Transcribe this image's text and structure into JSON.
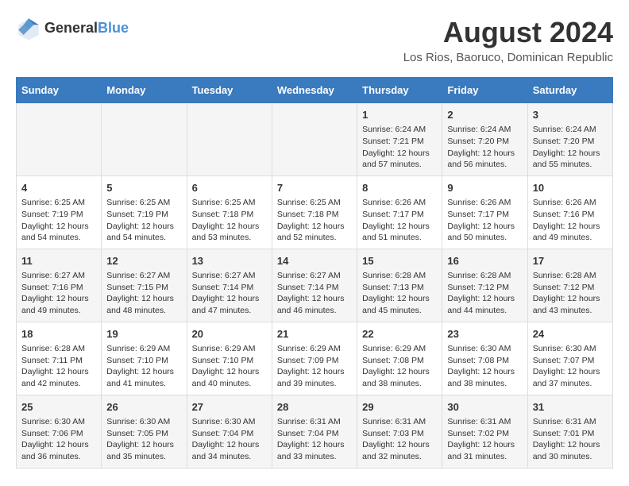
{
  "header": {
    "logo_line1": "General",
    "logo_line2": "Blue",
    "month": "August 2024",
    "location": "Los Rios, Baoruco, Dominican Republic"
  },
  "weekdays": [
    "Sunday",
    "Monday",
    "Tuesday",
    "Wednesday",
    "Thursday",
    "Friday",
    "Saturday"
  ],
  "weeks": [
    [
      {
        "day": "",
        "info": ""
      },
      {
        "day": "",
        "info": ""
      },
      {
        "day": "",
        "info": ""
      },
      {
        "day": "",
        "info": ""
      },
      {
        "day": "1",
        "info": "Sunrise: 6:24 AM\nSunset: 7:21 PM\nDaylight: 12 hours\nand 57 minutes."
      },
      {
        "day": "2",
        "info": "Sunrise: 6:24 AM\nSunset: 7:20 PM\nDaylight: 12 hours\nand 56 minutes."
      },
      {
        "day": "3",
        "info": "Sunrise: 6:24 AM\nSunset: 7:20 PM\nDaylight: 12 hours\nand 55 minutes."
      }
    ],
    [
      {
        "day": "4",
        "info": "Sunrise: 6:25 AM\nSunset: 7:19 PM\nDaylight: 12 hours\nand 54 minutes."
      },
      {
        "day": "5",
        "info": "Sunrise: 6:25 AM\nSunset: 7:19 PM\nDaylight: 12 hours\nand 54 minutes."
      },
      {
        "day": "6",
        "info": "Sunrise: 6:25 AM\nSunset: 7:18 PM\nDaylight: 12 hours\nand 53 minutes."
      },
      {
        "day": "7",
        "info": "Sunrise: 6:25 AM\nSunset: 7:18 PM\nDaylight: 12 hours\nand 52 minutes."
      },
      {
        "day": "8",
        "info": "Sunrise: 6:26 AM\nSunset: 7:17 PM\nDaylight: 12 hours\nand 51 minutes."
      },
      {
        "day": "9",
        "info": "Sunrise: 6:26 AM\nSunset: 7:17 PM\nDaylight: 12 hours\nand 50 minutes."
      },
      {
        "day": "10",
        "info": "Sunrise: 6:26 AM\nSunset: 7:16 PM\nDaylight: 12 hours\nand 49 minutes."
      }
    ],
    [
      {
        "day": "11",
        "info": "Sunrise: 6:27 AM\nSunset: 7:16 PM\nDaylight: 12 hours\nand 49 minutes."
      },
      {
        "day": "12",
        "info": "Sunrise: 6:27 AM\nSunset: 7:15 PM\nDaylight: 12 hours\nand 48 minutes."
      },
      {
        "day": "13",
        "info": "Sunrise: 6:27 AM\nSunset: 7:14 PM\nDaylight: 12 hours\nand 47 minutes."
      },
      {
        "day": "14",
        "info": "Sunrise: 6:27 AM\nSunset: 7:14 PM\nDaylight: 12 hours\nand 46 minutes."
      },
      {
        "day": "15",
        "info": "Sunrise: 6:28 AM\nSunset: 7:13 PM\nDaylight: 12 hours\nand 45 minutes."
      },
      {
        "day": "16",
        "info": "Sunrise: 6:28 AM\nSunset: 7:12 PM\nDaylight: 12 hours\nand 44 minutes."
      },
      {
        "day": "17",
        "info": "Sunrise: 6:28 AM\nSunset: 7:12 PM\nDaylight: 12 hours\nand 43 minutes."
      }
    ],
    [
      {
        "day": "18",
        "info": "Sunrise: 6:28 AM\nSunset: 7:11 PM\nDaylight: 12 hours\nand 42 minutes."
      },
      {
        "day": "19",
        "info": "Sunrise: 6:29 AM\nSunset: 7:10 PM\nDaylight: 12 hours\nand 41 minutes."
      },
      {
        "day": "20",
        "info": "Sunrise: 6:29 AM\nSunset: 7:10 PM\nDaylight: 12 hours\nand 40 minutes."
      },
      {
        "day": "21",
        "info": "Sunrise: 6:29 AM\nSunset: 7:09 PM\nDaylight: 12 hours\nand 39 minutes."
      },
      {
        "day": "22",
        "info": "Sunrise: 6:29 AM\nSunset: 7:08 PM\nDaylight: 12 hours\nand 38 minutes."
      },
      {
        "day": "23",
        "info": "Sunrise: 6:30 AM\nSunset: 7:08 PM\nDaylight: 12 hours\nand 38 minutes."
      },
      {
        "day": "24",
        "info": "Sunrise: 6:30 AM\nSunset: 7:07 PM\nDaylight: 12 hours\nand 37 minutes."
      }
    ],
    [
      {
        "day": "25",
        "info": "Sunrise: 6:30 AM\nSunset: 7:06 PM\nDaylight: 12 hours\nand 36 minutes."
      },
      {
        "day": "26",
        "info": "Sunrise: 6:30 AM\nSunset: 7:05 PM\nDaylight: 12 hours\nand 35 minutes."
      },
      {
        "day": "27",
        "info": "Sunrise: 6:30 AM\nSunset: 7:04 PM\nDaylight: 12 hours\nand 34 minutes."
      },
      {
        "day": "28",
        "info": "Sunrise: 6:31 AM\nSunset: 7:04 PM\nDaylight: 12 hours\nand 33 minutes."
      },
      {
        "day": "29",
        "info": "Sunrise: 6:31 AM\nSunset: 7:03 PM\nDaylight: 12 hours\nand 32 minutes."
      },
      {
        "day": "30",
        "info": "Sunrise: 6:31 AM\nSunset: 7:02 PM\nDaylight: 12 hours\nand 31 minutes."
      },
      {
        "day": "31",
        "info": "Sunrise: 6:31 AM\nSunset: 7:01 PM\nDaylight: 12 hours\nand 30 minutes."
      }
    ]
  ]
}
